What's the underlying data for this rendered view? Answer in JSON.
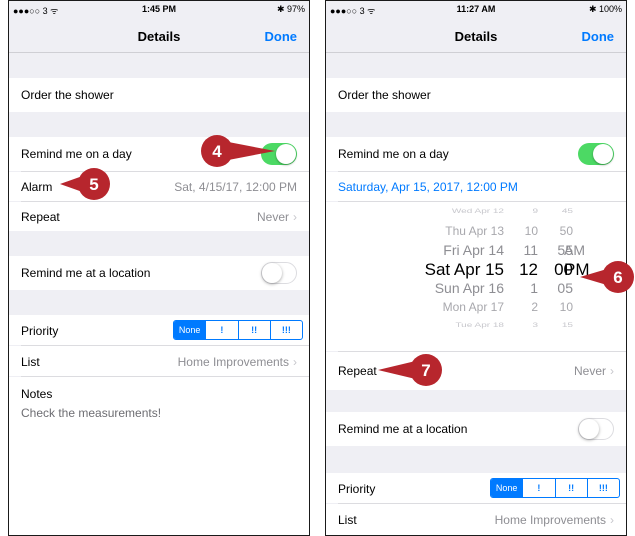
{
  "colors": {
    "accent": "#007aff",
    "toggle_on": "#4cd964",
    "callout": "#b7262d"
  },
  "left": {
    "status": {
      "signal": "●●●○○ 3 ᯤ",
      "time": "1:45 PM",
      "battery": "✱ 97%"
    },
    "nav": {
      "title": "Details",
      "done": "Done"
    },
    "task_title": "Order the shower",
    "remind_day_label": "Remind me on a day",
    "alarm_label": "Alarm",
    "alarm_value": "Sat, 4/15/17, 12:00 PM",
    "repeat_label": "Repeat",
    "repeat_value": "Never",
    "remind_location_label": "Remind me at a location",
    "priority_label": "Priority",
    "priority_options": [
      "None",
      "!",
      "!!",
      "!!!"
    ],
    "list_label": "List",
    "list_value": "Home Improvements",
    "notes_label": "Notes",
    "notes_text": "Check the measurements!"
  },
  "right": {
    "status": {
      "signal": "●●●○○ 3 ᯤ",
      "time": "11:27 AM",
      "battery": "✱ 100%"
    },
    "nav": {
      "title": "Details",
      "done": "Done"
    },
    "task_title": "Order the shower",
    "remind_day_label": "Remind me on a day",
    "date_value": "Saturday, Apr 15, 2017, 12:00 PM",
    "picker": {
      "dates": [
        "Wed Apr 12",
        "Thu Apr 13",
        "Fri Apr 14",
        "Sat Apr 15",
        "Sun Apr 16",
        "Mon Apr 17",
        "Tue Apr 18"
      ],
      "hours": [
        "9",
        "10",
        "11",
        "12",
        "1",
        "2",
        "3"
      ],
      "minutes": [
        "45",
        "50",
        "55",
        "00",
        "05",
        "10",
        "15"
      ],
      "ampm": [
        "AM",
        "PM"
      ],
      "selected_index": 3
    },
    "repeat_label": "Repeat",
    "repeat_value": "Never",
    "remind_location_label": "Remind me at a location",
    "priority_label": "Priority",
    "priority_options": [
      "None",
      "!",
      "!!",
      "!!!"
    ],
    "list_label": "List",
    "list_value": "Home Improvements"
  },
  "callouts": [
    "4",
    "5",
    "6",
    "7"
  ]
}
